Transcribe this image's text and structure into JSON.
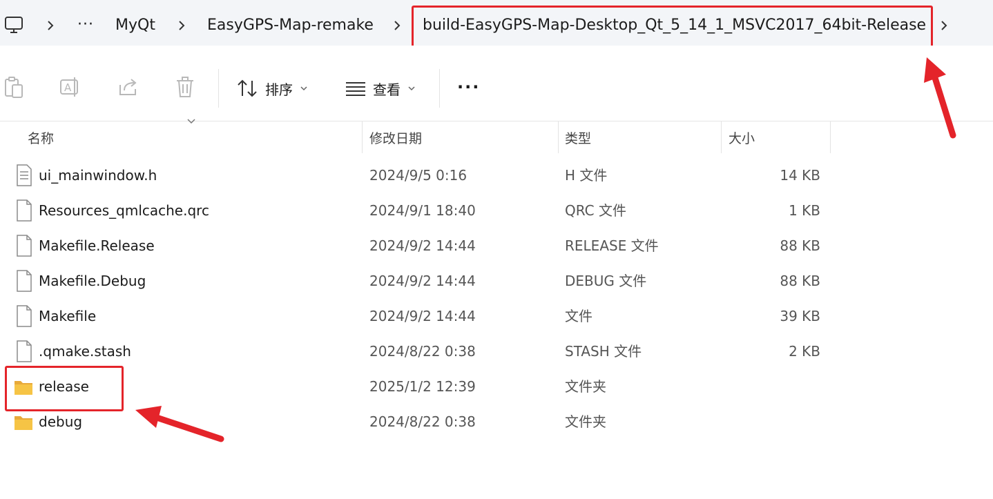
{
  "breadcrumb": {
    "items": [
      "MyQt",
      "EasyGPS-Map-remake",
      "build-EasyGPS-Map-Desktop_Qt_5_14_1_MSVC2017_64bit-Release"
    ],
    "overflow": "···"
  },
  "toolbar": {
    "sort_label": "排序",
    "view_label": "查看",
    "more_label": "···"
  },
  "columns": {
    "name": "名称",
    "date": "修改日期",
    "type": "类型",
    "size": "大小"
  },
  "files": [
    {
      "name": "ui_mainwindow.h",
      "date": "2024/9/5 0:16",
      "type": "H 文件",
      "size": "14 KB",
      "icon": "text-file-icon"
    },
    {
      "name": "Resources_qmlcache.qrc",
      "date": "2024/9/1 18:40",
      "type": "QRC 文件",
      "size": "1 KB",
      "icon": "file-icon"
    },
    {
      "name": "Makefile.Release",
      "date": "2024/9/2 14:44",
      "type": "RELEASE 文件",
      "size": "88 KB",
      "icon": "file-icon"
    },
    {
      "name": "Makefile.Debug",
      "date": "2024/9/2 14:44",
      "type": "DEBUG 文件",
      "size": "88 KB",
      "icon": "file-icon"
    },
    {
      "name": "Makefile",
      "date": "2024/9/2 14:44",
      "type": "文件",
      "size": "39 KB",
      "icon": "file-icon"
    },
    {
      "name": ".qmake.stash",
      "date": "2024/8/22 0:38",
      "type": "STASH 文件",
      "size": "2 KB",
      "icon": "file-icon"
    },
    {
      "name": "release",
      "date": "2025/1/2 12:39",
      "type": "文件夹",
      "size": "",
      "icon": "folder-icon"
    },
    {
      "name": "debug",
      "date": "2024/8/22 0:38",
      "type": "文件夹",
      "size": "",
      "icon": "folder-icon"
    }
  ],
  "colors": {
    "highlight": "#e4242a",
    "address_bg": "#f3f5f8",
    "folder": "#f6c445"
  }
}
